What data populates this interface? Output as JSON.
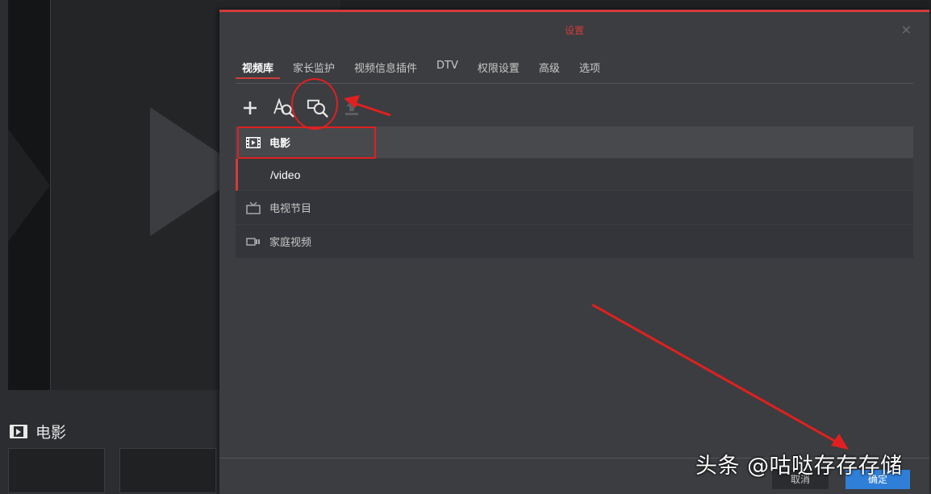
{
  "background": {
    "section_title": "电影",
    "icons": {
      "play": "play-icon",
      "film": "film-icon"
    }
  },
  "dialog": {
    "title": "设置",
    "close_symbol": "×",
    "tabs": [
      {
        "label": "视频库",
        "active": true
      },
      {
        "label": "家长监护",
        "active": false
      },
      {
        "label": "视频信息插件",
        "active": false
      },
      {
        "label": "DTV",
        "active": false
      },
      {
        "label": "权限设置",
        "active": false
      },
      {
        "label": "高级",
        "active": false
      },
      {
        "label": "选项",
        "active": false
      }
    ],
    "toolbar": [
      {
        "name": "add-icon"
      },
      {
        "name": "search-text-icon"
      },
      {
        "name": "scan-library-icon"
      },
      {
        "name": "upload-icon"
      }
    ],
    "libraries": [
      {
        "icon": "film-icon",
        "label": "电影",
        "selected": true,
        "path": "/video"
      },
      {
        "icon": "tv-icon",
        "label": "电视节目",
        "selected": false
      },
      {
        "icon": "camcorder-icon",
        "label": "家庭视频",
        "selected": false
      }
    ],
    "footer": {
      "cancel_label": "取消",
      "ok_label": "确定"
    }
  },
  "colors": {
    "accent": "#d33b3b",
    "primary_button": "#2f7ed8",
    "annotation": "#e02020"
  },
  "watermark": "头条 @咕哒存存存储"
}
